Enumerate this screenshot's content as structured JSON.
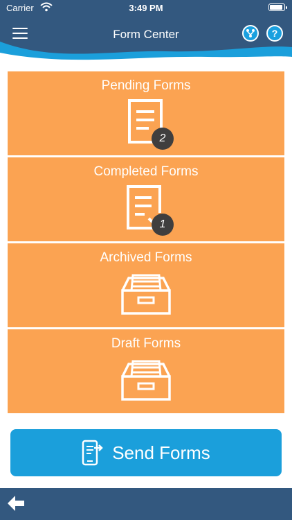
{
  "status_bar": {
    "carrier": "Carrier",
    "time": "3:49 PM"
  },
  "header": {
    "title": "Form Center",
    "help_glyph": "?"
  },
  "tiles": [
    {
      "label": "Pending Forms",
      "icon": "document-icon",
      "badge": "2"
    },
    {
      "label": "Completed Forms",
      "icon": "document-check-icon",
      "badge": "1"
    },
    {
      "label": "Archived Forms",
      "icon": "archive-drawer-icon"
    },
    {
      "label": "Draft Forms",
      "icon": "archive-drawer-icon"
    }
  ],
  "send_button": {
    "label": "Send Forms",
    "icon": "send-phone-icon"
  },
  "footer": {
    "back_icon": "back-arrow-icon"
  },
  "colors": {
    "header_bg": "#33587f",
    "tile_bg": "#fba352",
    "accent": "#1b9fdb",
    "badge_bg": "#3f3e3e"
  }
}
